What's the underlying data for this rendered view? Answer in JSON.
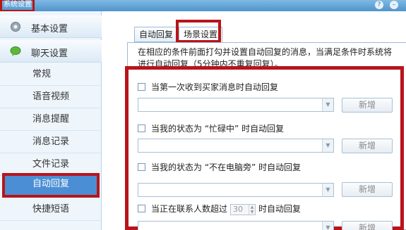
{
  "window": {
    "title": "系统设置",
    "help_glyph": "?",
    "minimize_glyph": "–"
  },
  "sidebar": {
    "groups": [
      {
        "label": "基本设置",
        "icon": "gear-icon"
      },
      {
        "label": "聊天设置",
        "icon": "chat-bubble-icon"
      }
    ],
    "items": [
      {
        "label": "常规"
      },
      {
        "label": "语音视频"
      },
      {
        "label": "消息提醒"
      },
      {
        "label": "消息记录"
      },
      {
        "label": "文件记录"
      },
      {
        "label": "自动回复",
        "active": true
      },
      {
        "label": "快捷短语"
      }
    ]
  },
  "tabs": [
    {
      "label": "自动回复"
    },
    {
      "label": "场景设置",
      "active": true
    }
  ],
  "description": "在相应的条件前面打勾并设置自动回复的消息，当满足条件时系统将进行自动回复（5分钟内不重复回复）。",
  "rules": [
    {
      "label": "当第一次收到买家消息时自动回复",
      "add_label": "新增"
    },
    {
      "label": "当我的状态为 “忙碌中” 时自动回复",
      "add_label": "新增"
    },
    {
      "label": "当我的状态为 “不在电脑旁” 时自动回复",
      "add_label": "新增"
    },
    {
      "label_before": "当正在联系人数超过",
      "count_value": "30",
      "label_after": "时自动回复",
      "add_label": "新增"
    }
  ],
  "colors": {
    "highlight": "#b8141a",
    "active_item": "#4b8ed4",
    "title_bar": "#5d9fd6"
  }
}
